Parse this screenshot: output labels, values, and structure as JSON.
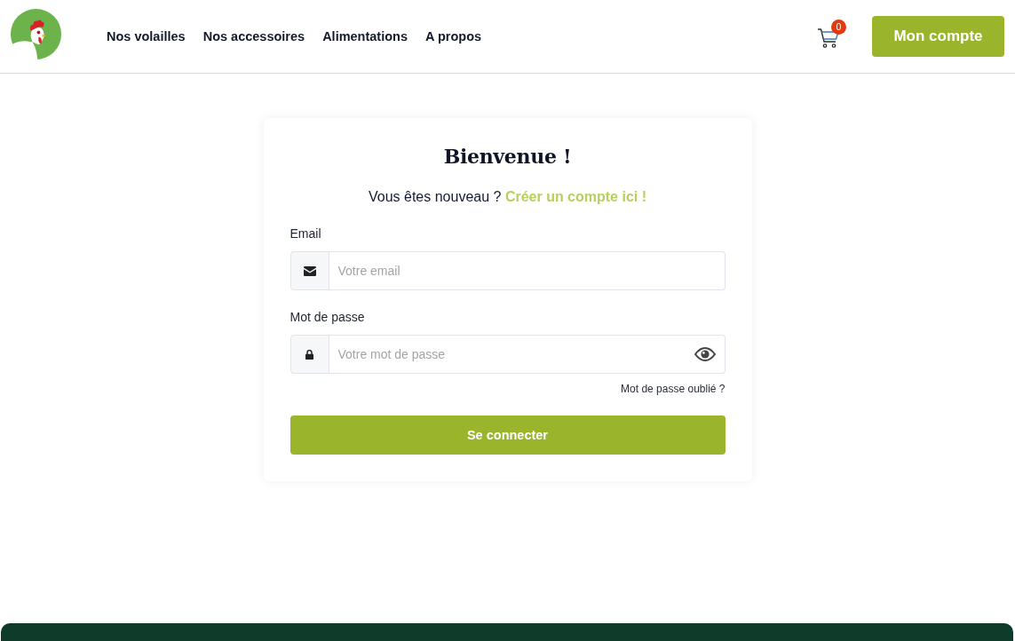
{
  "header": {
    "nav": [
      "Nos volailles",
      "Nos accessoires",
      "Alimentations",
      "A propos"
    ],
    "cart_count": "0",
    "account_button": "Mon compte"
  },
  "login": {
    "title": "Bienvenue !",
    "signup_prompt": "Vous êtes nouveau ?",
    "signup_link": "Créer un compte ici !",
    "fields": [
      {
        "kind": "email",
        "label": "Email",
        "placeholder": "Votre email"
      },
      {
        "kind": "password",
        "label": "Mot de passe",
        "placeholder": "Votre mot de passe"
      }
    ],
    "forgot_link": "Mot de passe oublié ?",
    "submit": "Se connecter"
  }
}
